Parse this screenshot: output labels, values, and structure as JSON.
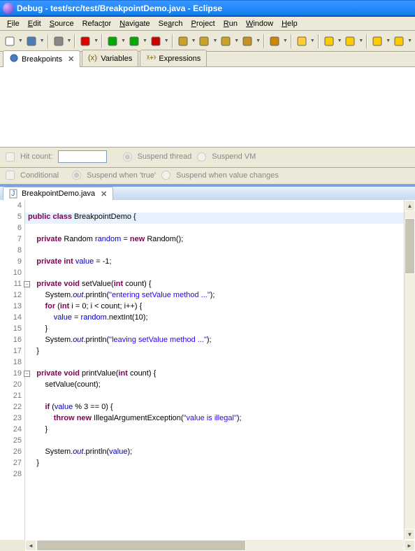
{
  "titlebar": {
    "text": "Debug - test/src/test/BreakpointDemo.java - Eclipse"
  },
  "menus": [
    {
      "label": "File",
      "u": "F"
    },
    {
      "label": "Edit",
      "u": "E"
    },
    {
      "label": "Source",
      "u": "S"
    },
    {
      "label": "Refactor",
      "u": "t"
    },
    {
      "label": "Navigate",
      "u": "N"
    },
    {
      "label": "Search",
      "u": "a"
    },
    {
      "label": "Project",
      "u": "P"
    },
    {
      "label": "Run",
      "u": "R"
    },
    {
      "label": "Window",
      "u": "W"
    },
    {
      "label": "Help",
      "u": "H"
    }
  ],
  "views": {
    "tabs": [
      {
        "label": "Breakpoints",
        "icon": "breakpoint-icon",
        "active": true
      },
      {
        "label": "Variables",
        "icon": "variables-icon",
        "active": false
      },
      {
        "label": "Expressions",
        "icon": "expressions-icon",
        "active": false
      }
    ]
  },
  "options": {
    "hitcount_label": "Hit count:",
    "hitcount_value": "",
    "suspend_thread": "Suspend thread",
    "suspend_vm": "Suspend VM",
    "conditional_label": "Conditional",
    "suspend_true": "Suspend when 'true'",
    "suspend_changes": "Suspend when value changes"
  },
  "editor": {
    "tab_label": "BreakpointDemo.java",
    "lines": [
      {
        "n": 4,
        "html": ""
      },
      {
        "n": 5,
        "html": "<span class='kw'>public</span> <span class='kw'>class</span> BreakpointDemo {",
        "hl": true
      },
      {
        "n": 6,
        "html": ""
      },
      {
        "n": 7,
        "html": "    <span class='kw'>private</span> Random <span class='fld'>random</span> = <span class='kw'>new</span> Random();"
      },
      {
        "n": 8,
        "html": ""
      },
      {
        "n": 9,
        "html": "    <span class='kw'>private</span> <span class='kw'>int</span> <span class='fld'>value</span> = -1;"
      },
      {
        "n": 10,
        "html": ""
      },
      {
        "n": 11,
        "html": "    <span class='kw'>private</span> <span class='kw'>void</span> setValue(<span class='kw'>int</span> count) {",
        "fold": true
      },
      {
        "n": 12,
        "html": "        System.<span class='stat'>out</span>.println(<span class='str'>\"entering setValue method ...\"</span>);"
      },
      {
        "n": 13,
        "html": "        <span class='kw'>for</span> (<span class='kw'>int</span> i = 0; i &lt; count; i++) {"
      },
      {
        "n": 14,
        "html": "            <span class='fld'>value</span> = <span class='fld'>random</span>.nextInt(10);"
      },
      {
        "n": 15,
        "html": "        }"
      },
      {
        "n": 16,
        "html": "        System.<span class='stat'>out</span>.println(<span class='str'>\"leaving setValue method ...\"</span>);"
      },
      {
        "n": 17,
        "html": "    }"
      },
      {
        "n": 18,
        "html": ""
      },
      {
        "n": 19,
        "html": "    <span class='kw'>private</span> <span class='kw'>void</span> printValue(<span class='kw'>int</span> count) {",
        "fold": true
      },
      {
        "n": 20,
        "html": "        setValue(count);"
      },
      {
        "n": 21,
        "html": ""
      },
      {
        "n": 22,
        "html": "        <span class='kw'>if</span> (<span class='fld'>value</span> % 3 == 0) {"
      },
      {
        "n": 23,
        "html": "            <span class='kw'>throw</span> <span class='kw'>new</span> IllegalArgumentException(<span class='str'>\"value is illegal\"</span>);"
      },
      {
        "n": 24,
        "html": "        }"
      },
      {
        "n": 25,
        "html": ""
      },
      {
        "n": 26,
        "html": "        System.<span class='stat'>out</span>.println(<span class='fld'>value</span>);"
      },
      {
        "n": 27,
        "html": "    }"
      },
      {
        "n": 28,
        "html": ""
      }
    ]
  },
  "toolbar_icons": [
    "new-icon",
    "save-icon",
    "sep",
    "print-icon",
    "sep",
    "build-icon",
    "sep",
    "debug-icon",
    "run-icon",
    "external-icon",
    "sep",
    "new-package-icon",
    "new-class-icon",
    "new-folder-icon",
    "open-type-icon",
    "sep",
    "search-icon",
    "sep",
    "annotate-icon",
    "sep",
    "prev-icon",
    "next-icon",
    "sep",
    "back-icon",
    "forward-icon"
  ]
}
